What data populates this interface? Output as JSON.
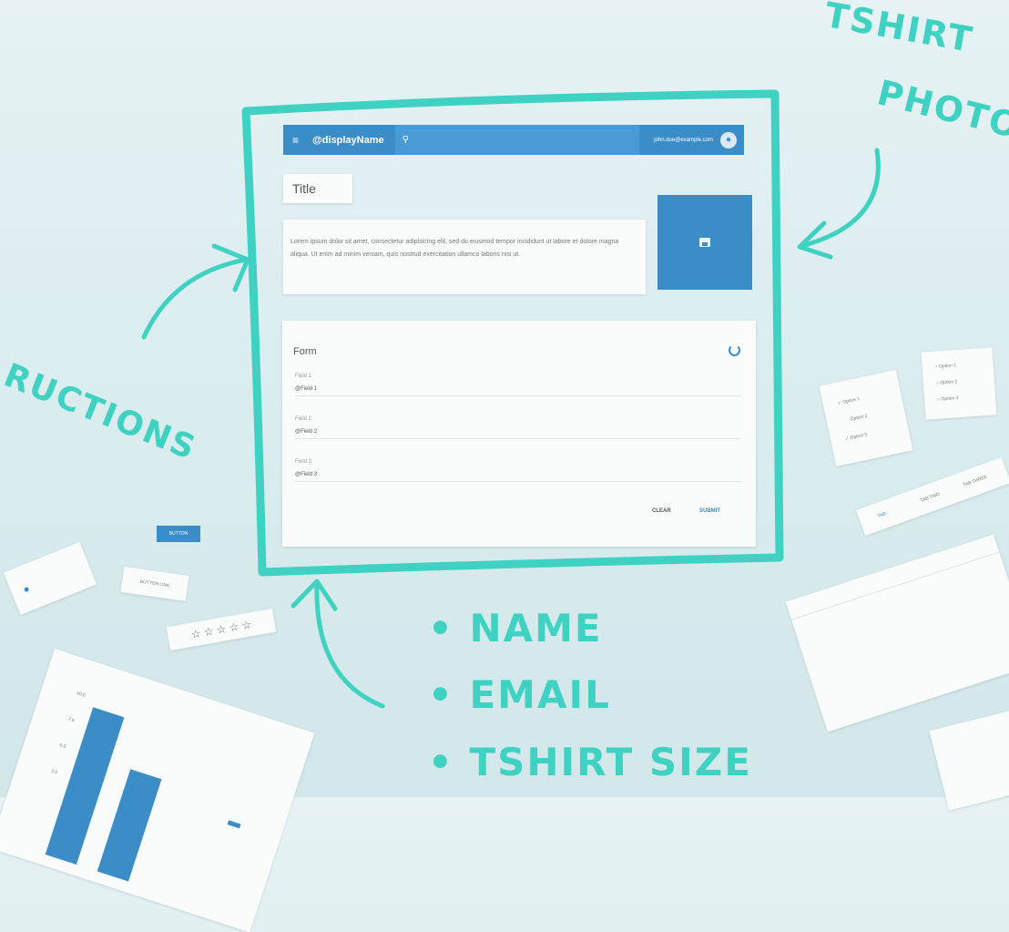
{
  "appbar": {
    "menu_icon": "≡",
    "display_name": "@displayName",
    "search_icon": "⚲",
    "email": "john.doe@example.com"
  },
  "card": {
    "title": "Title",
    "lorem": "Lorem ipsum dolor sit amet, consectetur adipisicing elit, sed do eiusmod tempor incididunt ut labore et dolore magna aliqua. Ut enim ad minim veniam, quis nostrud exercitation ullamco laboris nisi ut."
  },
  "form": {
    "title": "Form",
    "fields": [
      {
        "label": "Field 1",
        "value": "@Field 1"
      },
      {
        "label": "Field 2",
        "value": "@Field 2"
      },
      {
        "label": "Field 3",
        "value": "@Field 3"
      }
    ],
    "clear_label": "CLEAR",
    "submit_label": "SUBMIT"
  },
  "handwriting": {
    "tshirt": "TSHIRT",
    "photo": "PHOTO",
    "instructions": "RUCTIONS",
    "bullets": [
      "NAME",
      "EMAIL",
      "TSHIRT SIZE"
    ]
  },
  "widgets": {
    "checkbox_options": [
      "Option 1",
      "Option 2",
      "Option 3"
    ],
    "radio_options": [
      "Option 1",
      "Option 2",
      "Option 3"
    ],
    "tabs": [
      "TAB",
      "TAB TWO",
      "TAB THREE"
    ],
    "button_label": "BUTTON",
    "button_link_label": "BUTTON LINK",
    "stars": "☆ ☆ ☆ ☆ ☆",
    "chart_ticks": [
      "10.0",
      "7.5",
      "5.0",
      "2.5",
      "0.0"
    ]
  },
  "colors": {
    "marker": "#3fd1c1",
    "primary": "#3b8dc8"
  }
}
